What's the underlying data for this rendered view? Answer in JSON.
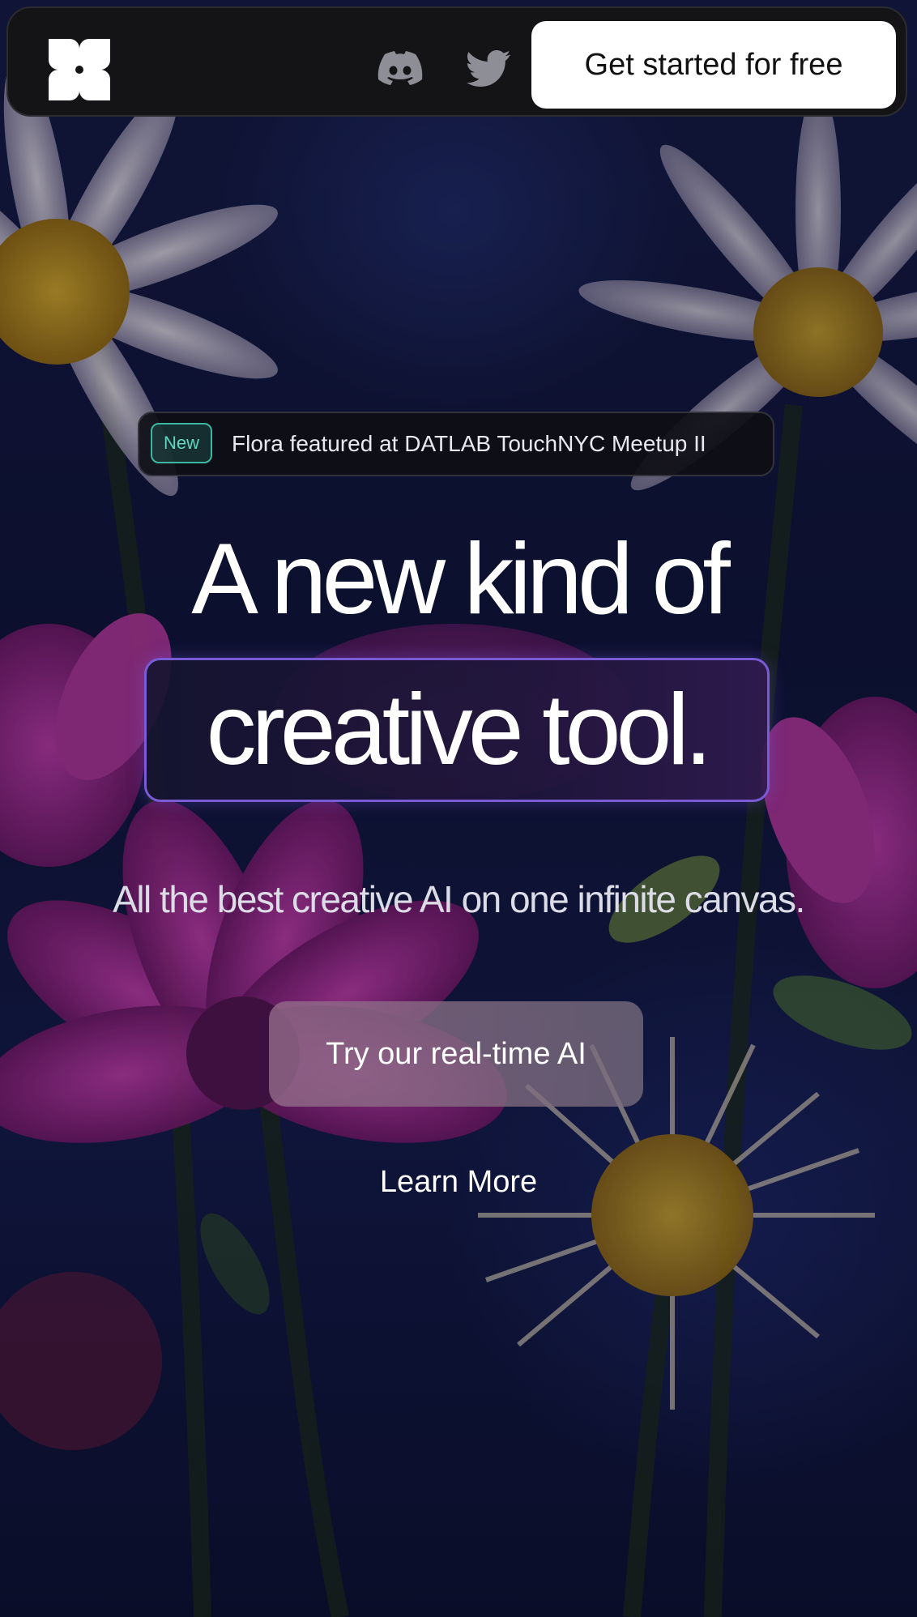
{
  "nav": {
    "logo_icon": "flora-logo-icon",
    "discord_icon": "discord-icon",
    "twitter_icon": "twitter-icon",
    "cta_label": "Get started for free"
  },
  "announcement": {
    "badge": "New",
    "text": "Flora featured at DATLAB TouchNYC Meetup II"
  },
  "hero": {
    "headline_line1": "A new kind of",
    "headline_line2": "creative tool.",
    "subtitle": "All the best creative AI on one infinite canvas.",
    "primary_button": "Try our real-time AI",
    "secondary_link": "Learn More"
  },
  "colors": {
    "accent_border": "#7a5bd6",
    "badge_teal": "#3ab8a0",
    "nav_bg": "#141416"
  }
}
